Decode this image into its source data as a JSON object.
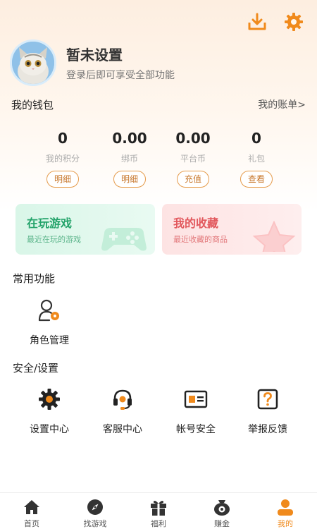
{
  "header": {
    "download_icon": "download-icon",
    "settings_icon": "gear-icon"
  },
  "profile": {
    "name": "暂未设置",
    "subtitle": "登录后即可享受全部功能"
  },
  "wallet": {
    "title": "我的钱包",
    "bill_link": "我的账单>",
    "items": [
      {
        "value": "0",
        "label": "我的积分",
        "button": "明细"
      },
      {
        "value": "0.00",
        "label": "绑币",
        "button": "明细"
      },
      {
        "value": "0.00",
        "label": "平台币",
        "button": "充值"
      },
      {
        "value": "0",
        "label": "礼包",
        "button": "查看"
      }
    ]
  },
  "cards": {
    "playing": {
      "title": "在玩游戏",
      "subtitle": "最近在玩的游戏"
    },
    "favorites": {
      "title": "我的收藏",
      "subtitle": "最近收藏的商品"
    }
  },
  "common": {
    "title": "常用功能",
    "items": [
      {
        "label": "角色管理",
        "icon": "role-management-icon"
      }
    ]
  },
  "security": {
    "title": "安全/设置",
    "items": [
      {
        "label": "设置中心",
        "icon": "gear-icon"
      },
      {
        "label": "客服中心",
        "icon": "headset-icon"
      },
      {
        "label": "帐号安全",
        "icon": "id-card-icon"
      },
      {
        "label": "举报反馈",
        "icon": "question-icon"
      }
    ]
  },
  "tabbar": {
    "items": [
      {
        "label": "首页",
        "icon": "home-icon"
      },
      {
        "label": "找游戏",
        "icon": "compass-icon"
      },
      {
        "label": "福利",
        "icon": "gift-icon"
      },
      {
        "label": "赚金",
        "icon": "coin-bag-icon"
      },
      {
        "label": "我的",
        "icon": "user-icon",
        "active": true
      }
    ]
  },
  "colors": {
    "accent": "#f08a1c",
    "green": "#23a36a",
    "red": "#e2585d"
  }
}
